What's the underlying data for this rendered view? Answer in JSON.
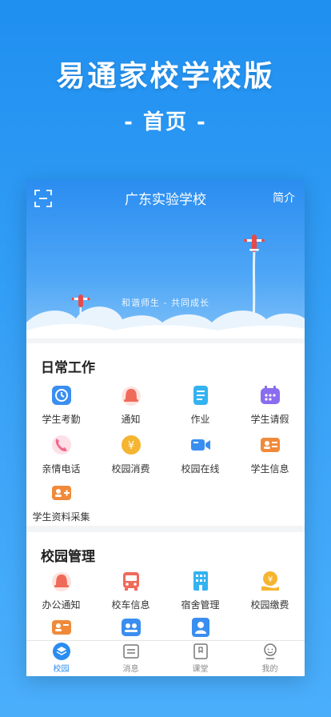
{
  "promo": {
    "title": "易通家校学校版",
    "subtitle": "- 首页 -"
  },
  "header": {
    "school_name": "广东实验学校",
    "intro_label": "简介",
    "scan_icon": "scan-icon",
    "slogan": "和谐师生 - 共同成长"
  },
  "daily_work": {
    "title": "日常工作",
    "items": [
      {
        "label": "学生考勤",
        "icon": "clock-icon",
        "color": "#3a8ef0"
      },
      {
        "label": "通知",
        "icon": "bell-icon",
        "color": "#f06a5a"
      },
      {
        "label": "作业",
        "icon": "homework-icon",
        "color": "#33b3f0"
      },
      {
        "label": "学生请假",
        "icon": "calendar-icon",
        "color": "#8a6cf0"
      },
      {
        "label": "亲情电话",
        "icon": "phone-icon",
        "color": "#f06a8a"
      },
      {
        "label": "校园消费",
        "icon": "yuan-coin-icon",
        "color": "#f5b531"
      },
      {
        "label": "校园在线",
        "icon": "video-camera-icon",
        "color": "#3a8ef0"
      },
      {
        "label": "学生信息",
        "icon": "id-card-icon",
        "color": "#f08a3a"
      },
      {
        "label": "学生资料采集",
        "icon": "add-profile-icon",
        "color": "#f08a3a"
      }
    ]
  },
  "campus_management": {
    "title": "校园管理",
    "items": [
      {
        "label": "办公通知",
        "icon": "office-bell-icon",
        "color": "#f06a5a"
      },
      {
        "label": "校车信息",
        "icon": "bus-icon",
        "color": "#f06a5a"
      },
      {
        "label": "宿舍管理",
        "icon": "building-icon",
        "color": "#33b3f0"
      },
      {
        "label": "校园缴费",
        "icon": "payment-icon",
        "color": "#f5b531"
      },
      {
        "label": "",
        "icon": "id-card-icon",
        "color": "#f08a3a"
      },
      {
        "label": "",
        "icon": "class-icon",
        "color": "#3a8ef0"
      },
      {
        "label": "",
        "icon": "user-icon",
        "color": "#3a8ef0"
      }
    ]
  },
  "tabbar": {
    "tabs": [
      {
        "label": "校园",
        "icon": "campus-icon",
        "active": true
      },
      {
        "label": "消息",
        "icon": "message-icon",
        "active": false
      },
      {
        "label": "课堂",
        "icon": "classroom-icon",
        "active": false
      },
      {
        "label": "我的",
        "icon": "profile-icon",
        "active": false
      }
    ]
  },
  "colors": {
    "accent": "#2a8cf0",
    "background_top": "#1f8ff0",
    "background_bottom": "#4aaefb"
  }
}
